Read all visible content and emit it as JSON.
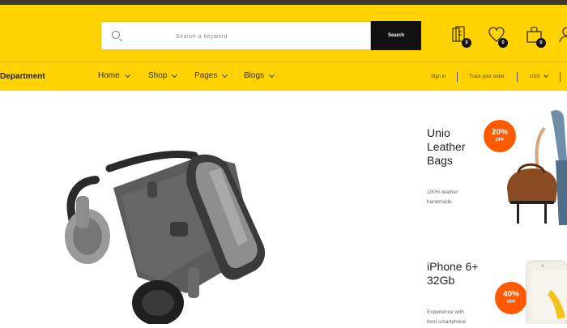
{
  "header": {
    "search": {
      "placeholder": "",
      "value": "Search a keyword",
      "button_label": "Search"
    },
    "icons": [
      {
        "name": "compare-icon",
        "count": "0"
      },
      {
        "name": "heart-icon",
        "count": "0"
      },
      {
        "name": "bag-icon",
        "count": "0"
      },
      {
        "name": "user-icon"
      }
    ]
  },
  "nav": {
    "department_label": "Department",
    "items": [
      {
        "label": "Home"
      },
      {
        "label": "Shop"
      },
      {
        "label": "Pages"
      },
      {
        "label": "Blogs"
      }
    ],
    "utility": {
      "signin": "Sign in",
      "track": "Track your order",
      "currency": "USD"
    }
  },
  "promos": [
    {
      "title_lines": [
        "Unio",
        "Leather",
        "Bags"
      ],
      "subtitle_lines": [
        "100% leather",
        "handmade"
      ],
      "discount": "20%",
      "off": "OFF"
    },
    {
      "title_lines": [
        "iPhone 6+",
        "32Gb"
      ],
      "subtitle_lines": [
        "Experience with",
        "best smartphone"
      ],
      "discount": "40%",
      "off": "OFF"
    }
  ],
  "colors": {
    "primary": "#ffd200",
    "topbar": "#3b3a2c",
    "button": "#111111",
    "accent": "#ff5a00"
  }
}
